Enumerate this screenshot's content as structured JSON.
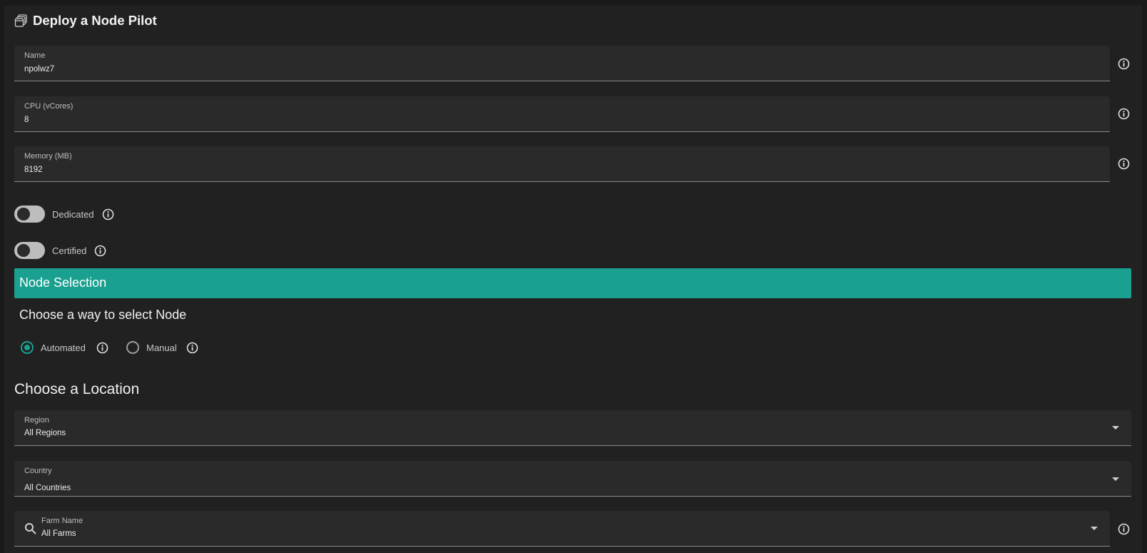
{
  "header": {
    "title": "Deploy a Node Pilot",
    "icon": "windows-stack-icon"
  },
  "fields": {
    "name": {
      "label": "Name",
      "value": "npolwz7"
    },
    "cpu": {
      "label": "CPU (vCores)",
      "value": "8"
    },
    "memory": {
      "label": "Memory (MB)",
      "value": "8192"
    }
  },
  "toggles": {
    "dedicated": {
      "label": "Dedicated",
      "on": false
    },
    "certified": {
      "label": "Certified",
      "on": false
    }
  },
  "node_selection": {
    "section_title": "Node Selection",
    "subtitle": "Choose a way to select Node",
    "options": [
      {
        "label": "Automated",
        "selected": true
      },
      {
        "label": "Manual",
        "selected": false
      }
    ]
  },
  "location": {
    "heading": "Choose a Location",
    "region": {
      "label": "Region",
      "value": "All Regions"
    },
    "country": {
      "label": "Country",
      "value": "All Countries"
    },
    "farm": {
      "label": "Farm Name",
      "value": "All Farms"
    }
  },
  "colors": {
    "accent": "#1aa090",
    "surface": "#212121",
    "field": "#2a2a2a"
  }
}
